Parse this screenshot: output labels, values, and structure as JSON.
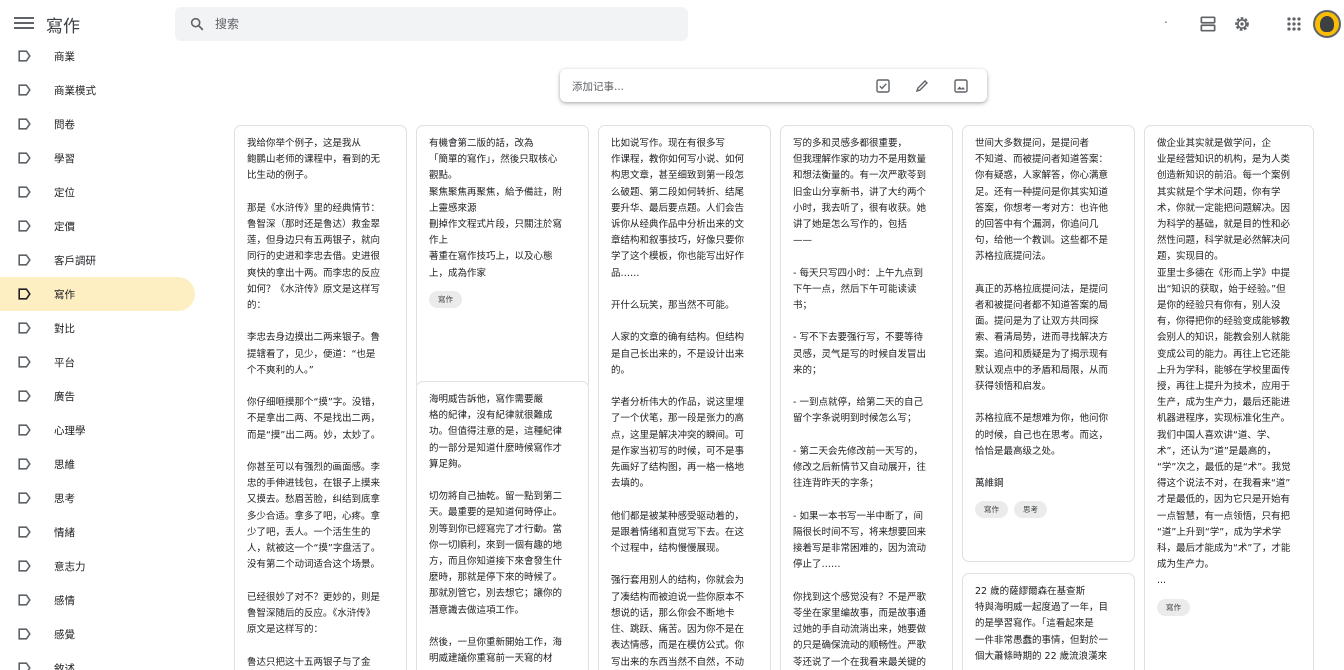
{
  "app": {
    "title": "寫作"
  },
  "search": {
    "placeholder": "搜索"
  },
  "header": {
    "dot_text": "."
  },
  "sidebar": {
    "items": [
      {
        "label": "商業"
      },
      {
        "label": "商業模式"
      },
      {
        "label": "問卷"
      },
      {
        "label": "學習"
      },
      {
        "label": "定位"
      },
      {
        "label": "定價"
      },
      {
        "label": "客戶調研"
      },
      {
        "label": "寫作",
        "active": true
      },
      {
        "label": "對比"
      },
      {
        "label": "平台"
      },
      {
        "label": "廣告"
      },
      {
        "label": "心理學"
      },
      {
        "label": "思維"
      },
      {
        "label": "思考"
      },
      {
        "label": "情緒"
      },
      {
        "label": "意志力"
      },
      {
        "label": "感情"
      },
      {
        "label": "感覺"
      },
      {
        "label": "敘述"
      }
    ]
  },
  "take_note": {
    "placeholder": "添加记事..."
  },
  "notes": [
    {
      "text": "我给你举个例子，这是我从\n鲍鹏山老师的课程中，看到的无\n比生动的例子。\n\n那是《水浒传》里的经典情节：\n鲁智深（那时还是鲁达）救金翠\n莲，但身边只有五两银子，就向\n同行的史进和李忠去借。史进很\n爽快的拿出十两。而李忠的反应\n如何？《水浒传》原文是这样写\n的：\n\n李忠去身边摸出二两来银子。鲁\n提辖看了，见少，便道：“也是\n个不爽利的人。”\n\n你仔细咂摸那个“摸”字。没错，\n不是拿出二两、不是找出二两，\n而是“摸”出二两。妙，太妙了。\n\n你甚至可以有强烈的画面感。李\n忠的手伸进钱包，在银子上摸来\n又摸去。愁眉苦脸，纠结到底拿\n多少合适。拿多了吧，心疼。拿\n少了吧，丢人。一个活生生的\n人，就被这一个“摸”字盘活了。\n没有第二个动词适合这个场景。\n\n已经很妙了对不？更妙的，则是\n鲁智深随后的反应。《水浒传》\n原文是这样写的：\n\n鲁达只把这十五两银子与了金",
      "labels": []
    },
    {
      "text": "有機會第二版的話，改為\n「簡單的寫作」，然後只取核心\n觀點。\n聚焦聚焦再聚焦，給予備註，附\n上靈感來源\n刪掉作文程式片段，只關注於寫\n作上\n著重在寫作技巧上，以及心態\n上，成為作家",
      "labels": [
        "寫作"
      ]
    },
    {
      "text": "海明威告訴他，寫作需要嚴\n格的紀律，沒有紀律就很難成\n功。但值得注意的是，這種紀律\n的一部分是知道什麼時候寫作才\n算足夠。\n\n切勿將自己抽乾。留一點到第二\n天。最重要的是知道何時停止。\n別等到你已經寫完了才行動。當\n你一切順利，來到一個有趣的地\n方，而且你知道接下來會發生什\n麼時，那就是停下來的時候了。\n那就別管它，別去想它；讓你的\n潛意識去做這項工作。\n\n然後，一旦你重新開始工作，海\n明威建議你重寫前一天寫的材",
      "labels": []
    },
    {
      "text": "比如说写作。现在有很多写\n作课程，教你如何写小说、如何\n构思文章，甚至细致到第一段怎\n么破题、第二段如何转折、结尾\n要升华、最后要点题。人们会告\n诉你从经典作品中分析出来的文\n章结构和叙事技巧，好像只要你\n学了这个模板，你也能写出好作\n品……\n\n开什么玩笑，那当然不可能。\n\n人家的文章的确有结构。但结构\n是自己长出来的，不是设计出来\n的。\n\n学者分析伟大的作品，说这里埋\n了一个伏笔，那一段是张力的高\n点，这里是解决冲突的瞬间。可\n是作家当初写的时候，可不是事\n先画好了结构图，再一格一格地\n去填的。\n\n他们都是被某种感受驱动着的，\n是跟着情绪和直觉写下去。在这\n个过程中，结构慢慢展现。\n\n强行套用别人的结构，你就会为\n了凑结构而被迫说一些你原本不\n想说的话，那么你会不断地卡\n住、跳跃、痛苦。因为你不是在\n表达情感，而是在模仿公式。你\n写出来的东西当然不自然，不动",
      "labels": []
    },
    {
      "text": "写的多和灵感多都很重要，\n但我理解作家的功力不是用数量\n和想法衡量的。有一次严歌苓到\n旧金山分享新书，讲了大约两个\n小时，我去听了，很有收获。她\n讲了她是怎么写作的，包括\n——\n\n- 每天只写四小时：上午九点到\n下午一点，然后下午可能读读\n书；\n\n- 写不下去要强行写，不要等待\n灵感，灵气是写的时候自发冒出\n来的；\n\n- 一到点就停，给第二天的自己\n留个字条说明到时候怎么写；\n\n- 第二天会先修改前一天写的，\n修改之后新情节又自动展开，往\n往连背昨天的字条；\n\n- 如果一本书写一半中断了，间\n隔很长时间不写，将来想要回来\n接着写是非常困难的，因为流动\n停止了……\n\n你找到这个感觉没有？不是严歌\n苓坐在家里编故事，而是故事通\n过她的手自动流淌出来，她要做\n的只是确保流动的顺畅性。严歌\n苓还说了一个在我看来最关键的",
      "labels": []
    },
    {
      "text": "世间大多数提问，是提问者\n不知道、而被提问者知道答案：\n你有疑惑，人家解答，你心满意\n足。还有一种提问是你其实知道\n答案，你想考一考对方：也许他\n的回答中有个漏洞，你追问几\n句，给他一个教训。这些都不是\n苏格拉底提问法。\n\n真正的苏格拉底提问法，是提问\n者和被提问者都不知道答案的局\n面。提问是为了让双方共同探\n索、看清局势，进而寻找解决方\n案。追问和质疑是为了揭示现有\n默认观点中的矛盾和局限，从而\n获得领悟和启发。\n\n苏格拉底不是想难为你，他问你\n的时候，自己也在思考。而这，\n恰恰是最高级之处。\n\n萬維鋼",
      "labels": [
        "寫作",
        "思考"
      ]
    },
    {
      "text": "22 歲的薩繆爾森在基查斯\n特與海明威一起度過了一年，目\n的是學習寫作。「這看起來是\n一件非常愚蠢的事情，但對於一\n個大蕭條時期的 22 歲流浪漢來",
      "labels": []
    },
    {
      "text": "做企业其实就是做学问，企\n业是经营知识的机构，是为人类\n创造新知识的前沿。每一个案例\n其实就是个学术问题，你有学\n术，你就一定能把问题解决。因\n为科学的基础，就是目的性和必\n然性问题，科学就是必然解决问\n题，实现目的。\n亚里士多德在《形而上学》中提\n出“知识的获取，始于经验。”但\n是你的经验只有你有，别人没\n有，你得把你的经验变成能够教\n会别人的知识，能教会别人就能\n变成公司的能力。再往上它还能\n上升为学科，能够在学校里面传\n授，再往上提升为技术，应用于\n生产，成为生产力，最后还能进\n机器进程序，实现标准化生产。\n我们中国人喜欢讲“道、学、\n术”，还认为“道”是最高的，\n“学”次之，最低的是“术”。我觉\n得这个说法不对，在我看来“道”\n才是最低的，因为它只是开始有\n一点智慧，有一点领悟，只有把\n“道”上升到“学”，成为学术学\n科，最后才能成为“术”了，才能\n成为生产力。\n...",
      "labels": [
        "寫作"
      ]
    }
  ]
}
